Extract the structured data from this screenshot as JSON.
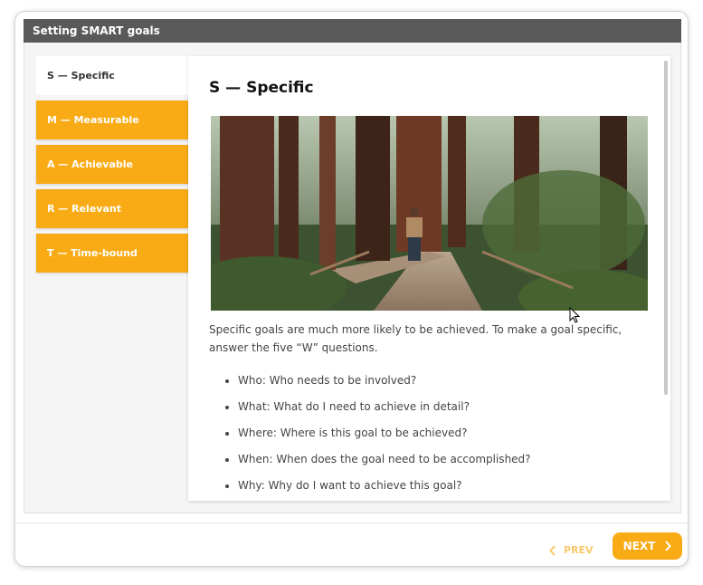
{
  "header": {
    "title": "Setting SMART goals"
  },
  "tabs": [
    {
      "label": "S — Specific",
      "active": true
    },
    {
      "label": "M — Measurable"
    },
    {
      "label": "A — Achievable"
    },
    {
      "label": "R — Relevant"
    },
    {
      "label": "T — Time-bound"
    }
  ],
  "content": {
    "heading": "S — Specific",
    "paragraph": "Specific goals are much more likely to be achieved. To make a goal specific, answer the five “W” questions.",
    "bullets": [
      "Who: Who needs to be involved?",
      "What: What do I need to achieve in detail?",
      "Where: Where is this goal to be achieved?",
      "When: When does the goal need to be accomplished?",
      "Why: Why do I want to achieve this goal?"
    ]
  },
  "footer": {
    "prev_label": "PREV",
    "next_label": "NEXT"
  },
  "colors": {
    "accent": "#f9ab15",
    "header": "#595959"
  },
  "icons": {
    "prev": "chevron-left-icon",
    "next": "chevron-right-icon",
    "cursor": "mouse-pointer-icon"
  }
}
